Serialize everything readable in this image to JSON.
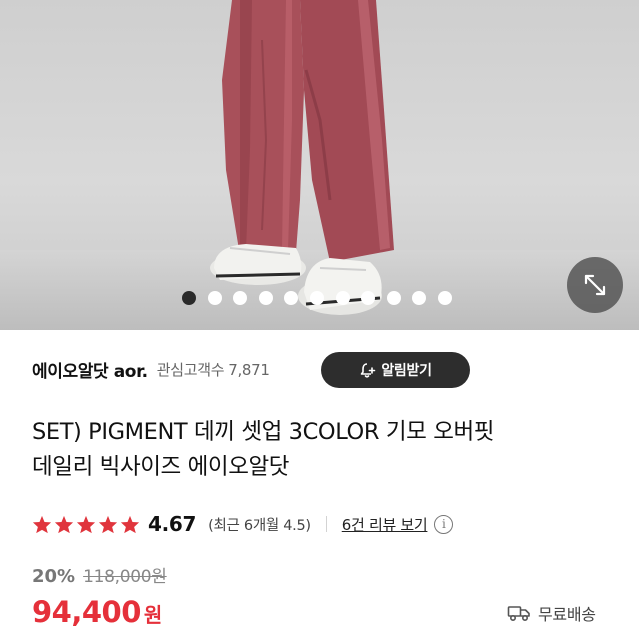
{
  "hero": {
    "dots_total": 11,
    "active_dot_index": 0
  },
  "shop": {
    "name": "에이오알닷 aor.",
    "followers_label": "관심고객수",
    "followers_count": "7,871",
    "notify_label": "알림받기"
  },
  "product": {
    "title_line1": "SET) PIGMENT 데끼 셋업 3COLOR 기모 오버핏",
    "title_line2": "데일리 빅사이즈 에이오알닷"
  },
  "rating": {
    "stars": 5,
    "value": "4.67",
    "recent": "(최근 6개월 4.5)",
    "reviews_link": "6건 리뷰 보기",
    "info_icon": "i"
  },
  "price": {
    "discount": "20%",
    "original": "118,000원",
    "sale": "94,400",
    "currency": "원"
  },
  "shipping": {
    "label": "무료배송"
  },
  "colors": {
    "accent_red": "#e5303a",
    "star_red": "#e0353d",
    "dark_button": "#2d2d2d"
  }
}
